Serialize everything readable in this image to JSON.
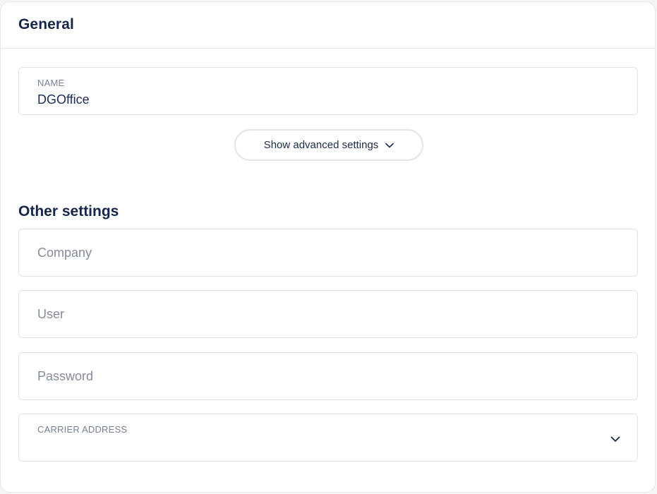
{
  "general": {
    "title": "General",
    "name_field": {
      "label": "NAME",
      "value": "DGOffice"
    },
    "advanced_button": {
      "label": "Show advanced settings",
      "icon": "chevron-down-icon"
    }
  },
  "other_settings": {
    "title": "Other settings",
    "company": {
      "placeholder": "Company",
      "value": ""
    },
    "user": {
      "placeholder": "User",
      "value": ""
    },
    "password": {
      "placeholder": "Password",
      "value": ""
    },
    "carrier_address": {
      "label": "CARRIER ADDRESS",
      "value": "",
      "icon": "chevron-down-icon"
    }
  },
  "colors": {
    "heading": "#15264a",
    "text": "#1b2b5c",
    "muted": "#7a8193",
    "border": "#e1e3e8"
  }
}
